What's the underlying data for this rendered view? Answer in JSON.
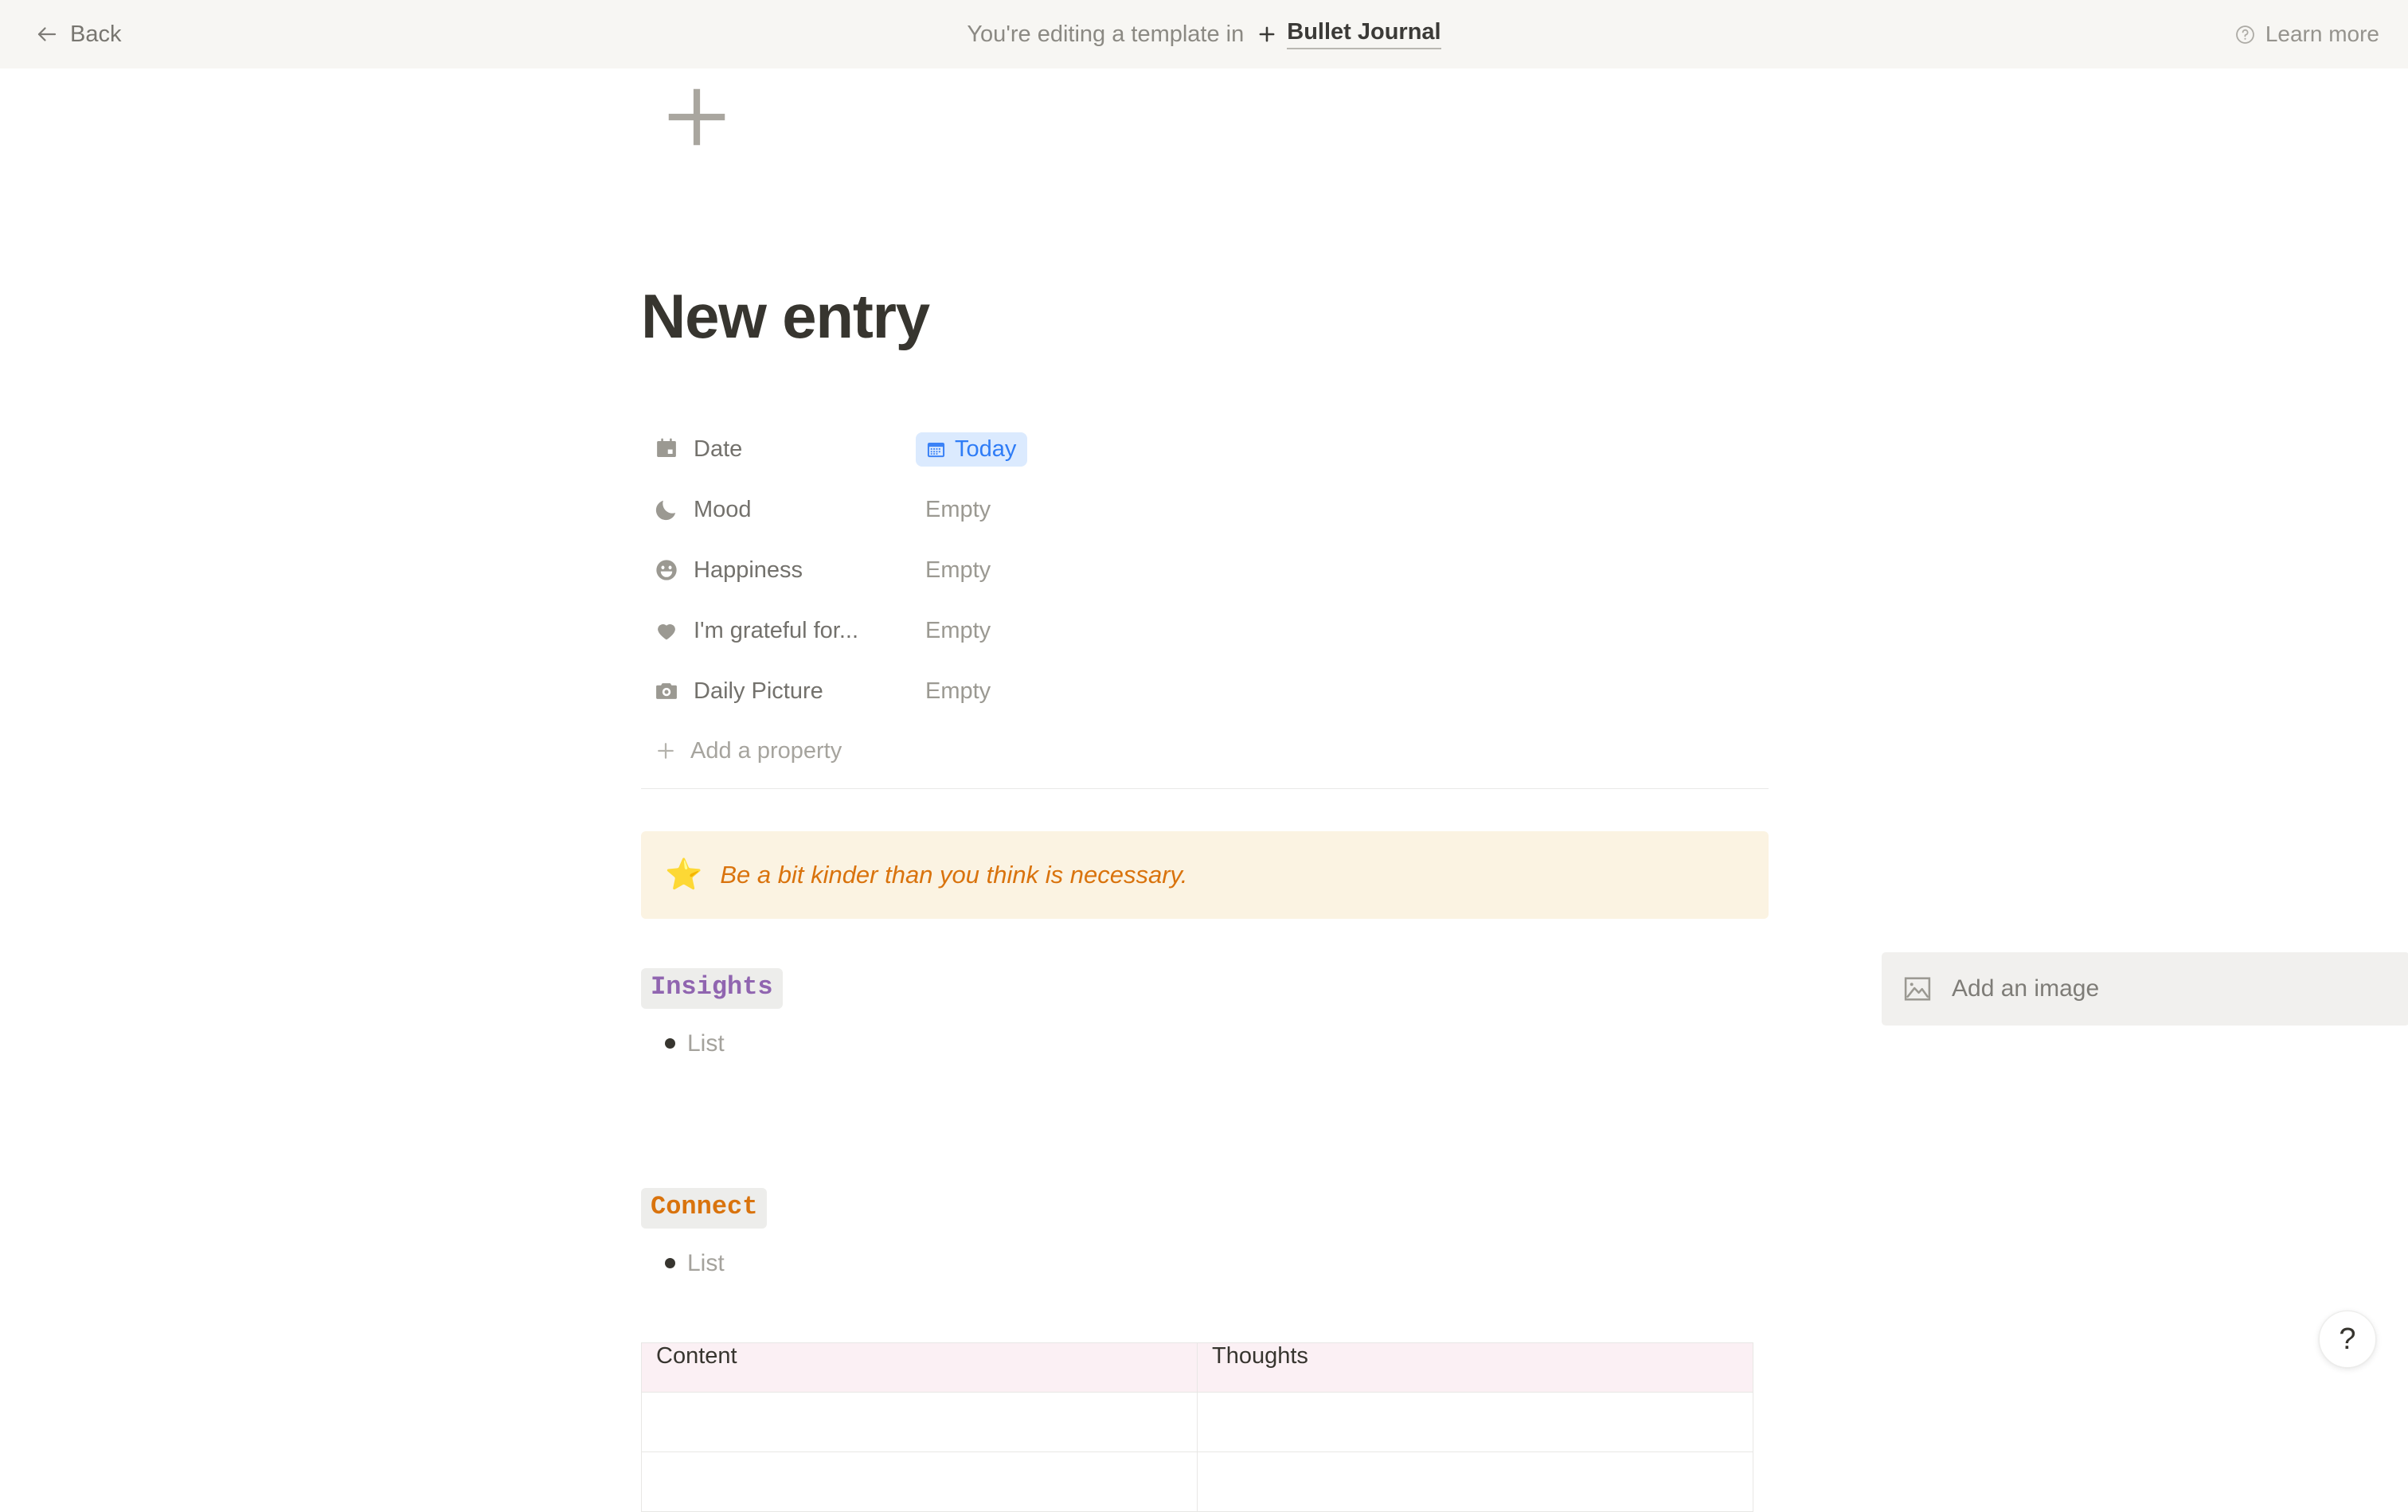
{
  "topbar": {
    "back_label": "Back",
    "back_icon": "arrow-left-icon",
    "editing_text": "You're editing a template in",
    "template_plus_icon": "plus-icon",
    "template_name": "Bullet Journal",
    "learn_more_label": "Learn more",
    "learn_more_icon": "question-circle-icon",
    "background_color": "#F7F6F3"
  },
  "page": {
    "icon_placeholder": "plus-icon",
    "title": "New entry",
    "properties": [
      {
        "icon": "calendar-icon",
        "label": "Date",
        "value": "Today",
        "value_type": "date-pill",
        "pill_bg": "#DBEAFE",
        "pill_fg": "#2E7CF6",
        "pill_icon": "calendar-blue-icon"
      },
      {
        "icon": "moon-icon",
        "label": "Mood",
        "value": "Empty",
        "value_type": "empty"
      },
      {
        "icon": "smiley-face-icon",
        "label": "Happiness",
        "value": "Empty",
        "value_type": "empty"
      },
      {
        "icon": "heart-icon",
        "label": "I'm grateful for...",
        "value": "Empty",
        "value_type": "empty"
      },
      {
        "icon": "camera-icon",
        "label": "Daily Picture",
        "value": "Empty",
        "value_type": "empty"
      }
    ],
    "add_property": {
      "icon": "plus-icon",
      "label": "Add a property"
    },
    "callout": {
      "emoji": "⭐",
      "emoji_name": "star-emoji",
      "text": "Be a bit kinder than you think is necessary.",
      "background_color": "#FBF3E2",
      "text_color": "#D9730D"
    },
    "sections": [
      {
        "heading": "Insights",
        "heading_color": "#9065B0",
        "bullet": "List"
      },
      {
        "heading": "Connect",
        "heading_color": "#D9730D",
        "bullet": "List"
      }
    ],
    "add_image": {
      "icon": "image-placeholder-icon",
      "label": "Add an image"
    },
    "table": {
      "headers": [
        "Content",
        "Thoughts"
      ],
      "header_background": "#FBF0F4",
      "rows": [
        [
          "",
          ""
        ],
        [
          "",
          ""
        ]
      ]
    }
  },
  "help_fab": {
    "glyph": "?",
    "name": "help-button"
  }
}
